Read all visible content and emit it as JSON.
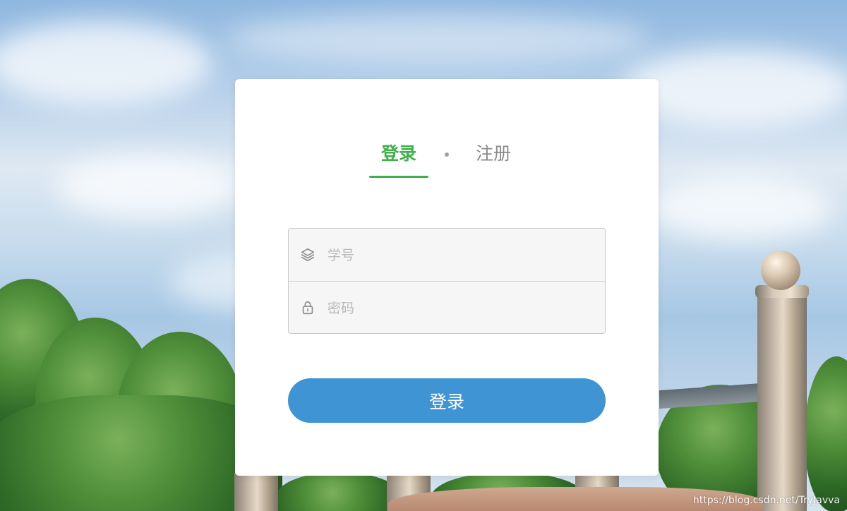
{
  "login_panel": {
    "tabs": {
      "active": "登录",
      "inactive": "注册",
      "separator": "•"
    },
    "fields": {
      "student_id": {
        "value": "",
        "placeholder": "学号",
        "icon": "layers-icon"
      },
      "password": {
        "value": "",
        "placeholder": "密码",
        "icon": "lock-icon"
      }
    },
    "submit_label": "登录"
  },
  "watermark": "https://blog.csdn.net/TryJavva",
  "colors": {
    "active_tab": "#3fb04c",
    "button": "#3f95d3",
    "field_background": "#f6f6f6"
  }
}
